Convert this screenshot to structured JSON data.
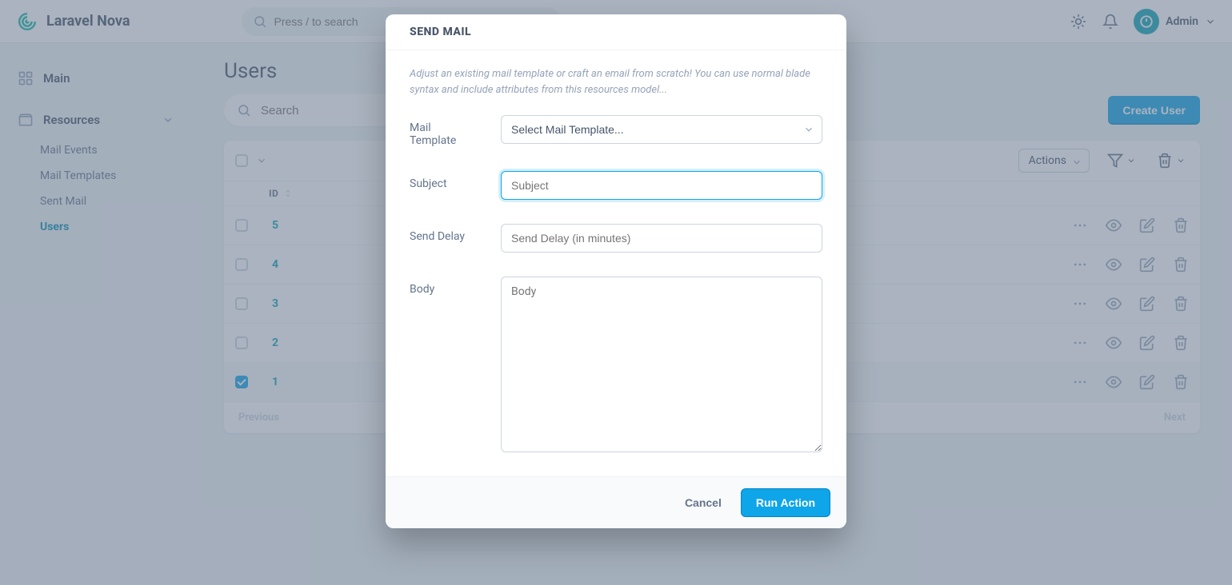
{
  "header": {
    "brand": "Laravel Nova",
    "search_placeholder": "Press / to search",
    "user_label": "Admin"
  },
  "sidebar": {
    "main_label": "Main",
    "resources_label": "Resources",
    "items": [
      {
        "label": "Mail Events",
        "active": false
      },
      {
        "label": "Mail Templates",
        "active": false
      },
      {
        "label": "Sent Mail",
        "active": false
      },
      {
        "label": "Users",
        "active": true
      }
    ]
  },
  "page": {
    "title": "Users",
    "search_placeholder": "Search",
    "create_button": "Create User",
    "actions_label": "Actions",
    "id_col": "ID",
    "prev": "Previous",
    "next": "Next",
    "rows": [
      {
        "id": "5",
        "checked": false
      },
      {
        "id": "4",
        "checked": false
      },
      {
        "id": "3",
        "checked": false
      },
      {
        "id": "2",
        "checked": false
      },
      {
        "id": "1",
        "checked": true
      }
    ]
  },
  "modal": {
    "title": "SEND MAIL",
    "description": "Adjust an existing mail template or craft an email from scratch! You can use normal blade syntax and include attributes from this resources model...",
    "fields": {
      "template_label": "Mail Template",
      "template_placeholder": "Select Mail Template...",
      "subject_label": "Subject",
      "subject_placeholder": "Subject",
      "delay_label": "Send Delay",
      "delay_placeholder": "Send Delay (in minutes)",
      "body_label": "Body",
      "body_placeholder": "Body"
    },
    "cancel": "Cancel",
    "run": "Run Action"
  }
}
